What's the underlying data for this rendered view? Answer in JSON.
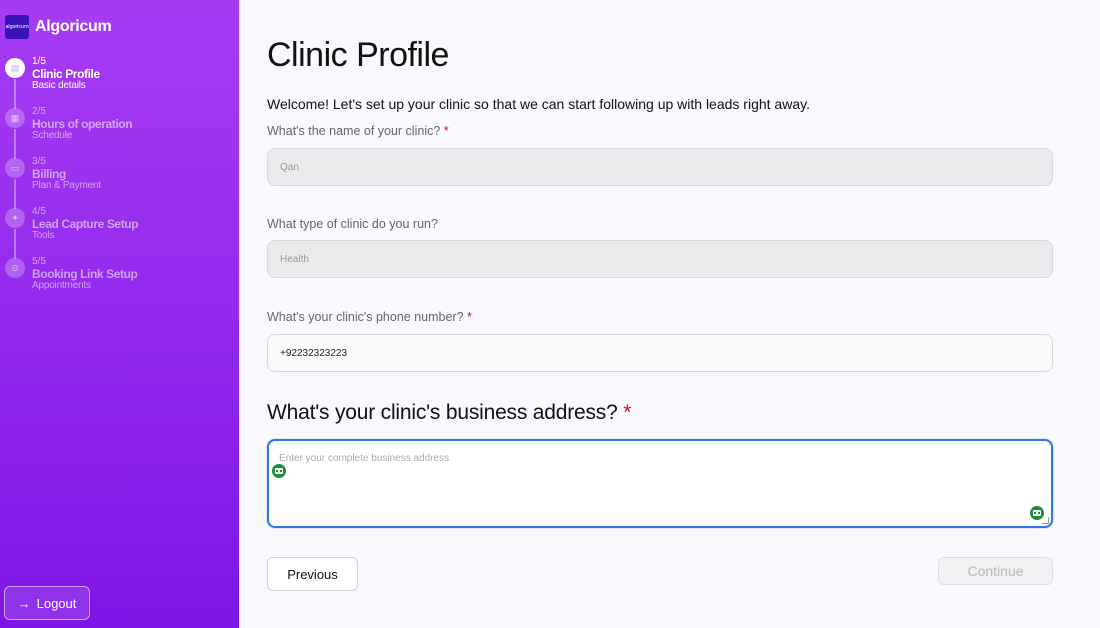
{
  "brand": {
    "logo_text": "algoricum",
    "name": "Algoricum"
  },
  "steps": [
    {
      "num": "1/5",
      "title": "Clinic Profile",
      "subtitle": "Basic details",
      "icon": "clipboard-icon",
      "state": "active"
    },
    {
      "num": "2/5",
      "title": "Hours of operation",
      "subtitle": "Schedule",
      "icon": "calendar-icon",
      "state": "inactive"
    },
    {
      "num": "3/5",
      "title": "Billing",
      "subtitle": "Plan & Payment",
      "icon": "credit-card-icon",
      "state": "inactive"
    },
    {
      "num": "4/5",
      "title": "Lead Capture Setup",
      "subtitle": "Tools",
      "icon": "magnet-icon",
      "state": "inactive"
    },
    {
      "num": "5/5",
      "title": "Booking Link Setup",
      "subtitle": "Appointments",
      "icon": "link-icon",
      "state": "inactive"
    }
  ],
  "logout": {
    "arrow": "→",
    "label": "Logout"
  },
  "page": {
    "title": "Clinic Profile",
    "welcome": "Welcome! Let's set up your clinic so that we can start following up with leads right away."
  },
  "form": {
    "clinic_name": {
      "label": "What's the name of your clinic?",
      "required_mark": "*",
      "value": "Qan"
    },
    "clinic_type": {
      "label": "What type of clinic do you run?",
      "value": "Health"
    },
    "phone": {
      "label": "What's your clinic's phone number?",
      "required_mark": "*",
      "value": "+92232323223"
    },
    "address": {
      "label": "What's your clinic's business address?",
      "required_mark": "*",
      "placeholder": "Enter your complete business address"
    }
  },
  "buttons": {
    "previous": "Previous",
    "continue": "Continue"
  },
  "colors": {
    "sidebar_top": "#a63cf2",
    "sidebar_bottom": "#7f15e6",
    "focus_border": "#2d7ae0",
    "required": "#d10d2c",
    "bot_icon": "#1e8e3e"
  }
}
